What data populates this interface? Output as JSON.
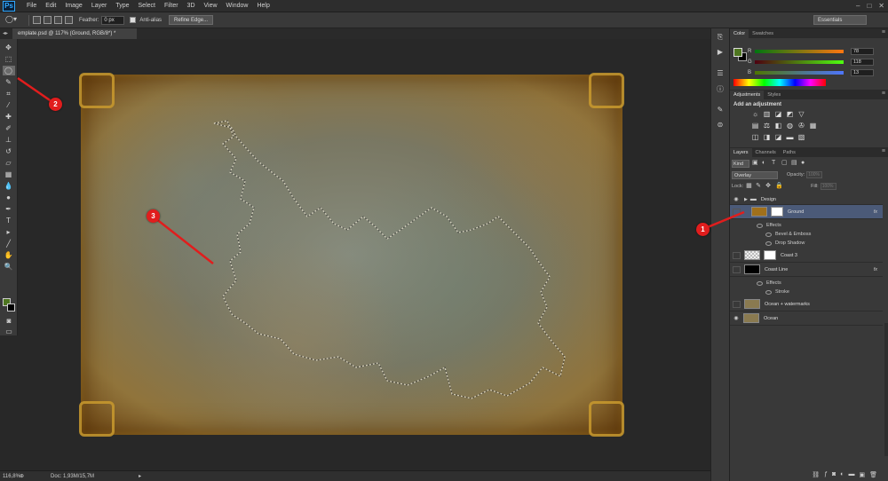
{
  "app": {
    "logo": "Ps",
    "menu": [
      "File",
      "Edit",
      "Image",
      "Layer",
      "Type",
      "Select",
      "Filter",
      "3D",
      "View",
      "Window",
      "Help"
    ],
    "window_buttons": [
      "–",
      "□",
      "✕"
    ]
  },
  "options_bar": {
    "feather_label": "Feather:",
    "feather_value": "0 px",
    "antialias_label": "Anti-alias",
    "refine_edge_label": "Refine Edge...",
    "workspace": "Essentials"
  },
  "document": {
    "tab_title": "emplate.psd @ 117% (Ground, RGB/8*) *",
    "zoom": "116,8%",
    "doc_info": "Doc: 1,93M/15,7M"
  },
  "toolbar": {
    "tools": [
      "move-tool",
      "marquee-tool",
      "lasso-tool",
      "quick-select-tool",
      "crop-tool",
      "eyedropper-tool",
      "healing-tool",
      "brush-tool",
      "stamp-tool",
      "history-brush-tool",
      "eraser-tool",
      "gradient-tool",
      "blur-tool",
      "dodge-tool",
      "pen-tool",
      "type-tool",
      "path-select-tool",
      "shape-tool",
      "hand-tool",
      "zoom-tool"
    ],
    "foreground_color": "#4e7620",
    "background_color": "#000000"
  },
  "color_panel": {
    "tabs": [
      "Color",
      "Swatches"
    ],
    "channels": [
      {
        "label": "R",
        "value": "78"
      },
      {
        "label": "G",
        "value": "118"
      },
      {
        "label": "B",
        "value": "13"
      }
    ]
  },
  "adjustments_panel": {
    "tabs": [
      "Adjustments",
      "Styles"
    ],
    "title": "Add an adjustment"
  },
  "layers_panel": {
    "tabs": [
      "Layers",
      "Channels",
      "Paths"
    ],
    "kind": "Kind",
    "blend_mode": "Overlay",
    "opacity_label": "Opacity:",
    "opacity_value": "100%",
    "lock_label": "Lock:",
    "fill_label": "Fill:",
    "fill_value": "100%",
    "layers": [
      {
        "name": "Design",
        "type": "group",
        "visible": true
      },
      {
        "name": "Ground",
        "type": "layer",
        "visible": false,
        "selected": true,
        "fx": "fx"
      },
      {
        "name": "Effects",
        "type": "effects-header"
      },
      {
        "name": "Bevel & Emboss",
        "type": "effect"
      },
      {
        "name": "Drop Shadow",
        "type": "effect"
      },
      {
        "name": "Coast 3",
        "type": "layer",
        "visible": false
      },
      {
        "name": "Coast Line",
        "type": "layer",
        "visible": false,
        "fx": "fx"
      },
      {
        "name": "Effects",
        "type": "effects-header"
      },
      {
        "name": "Stroke",
        "type": "effect"
      },
      {
        "name": "Ocean + watermarks",
        "type": "layer",
        "visible": false
      },
      {
        "name": "Ocean",
        "type": "layer",
        "visible": true
      }
    ]
  },
  "callouts": [
    {
      "label": "1"
    },
    {
      "label": "2"
    },
    {
      "label": "3"
    }
  ],
  "colors": {
    "callout": "#e11d1d",
    "selection_highlight": "#4b5a78"
  }
}
